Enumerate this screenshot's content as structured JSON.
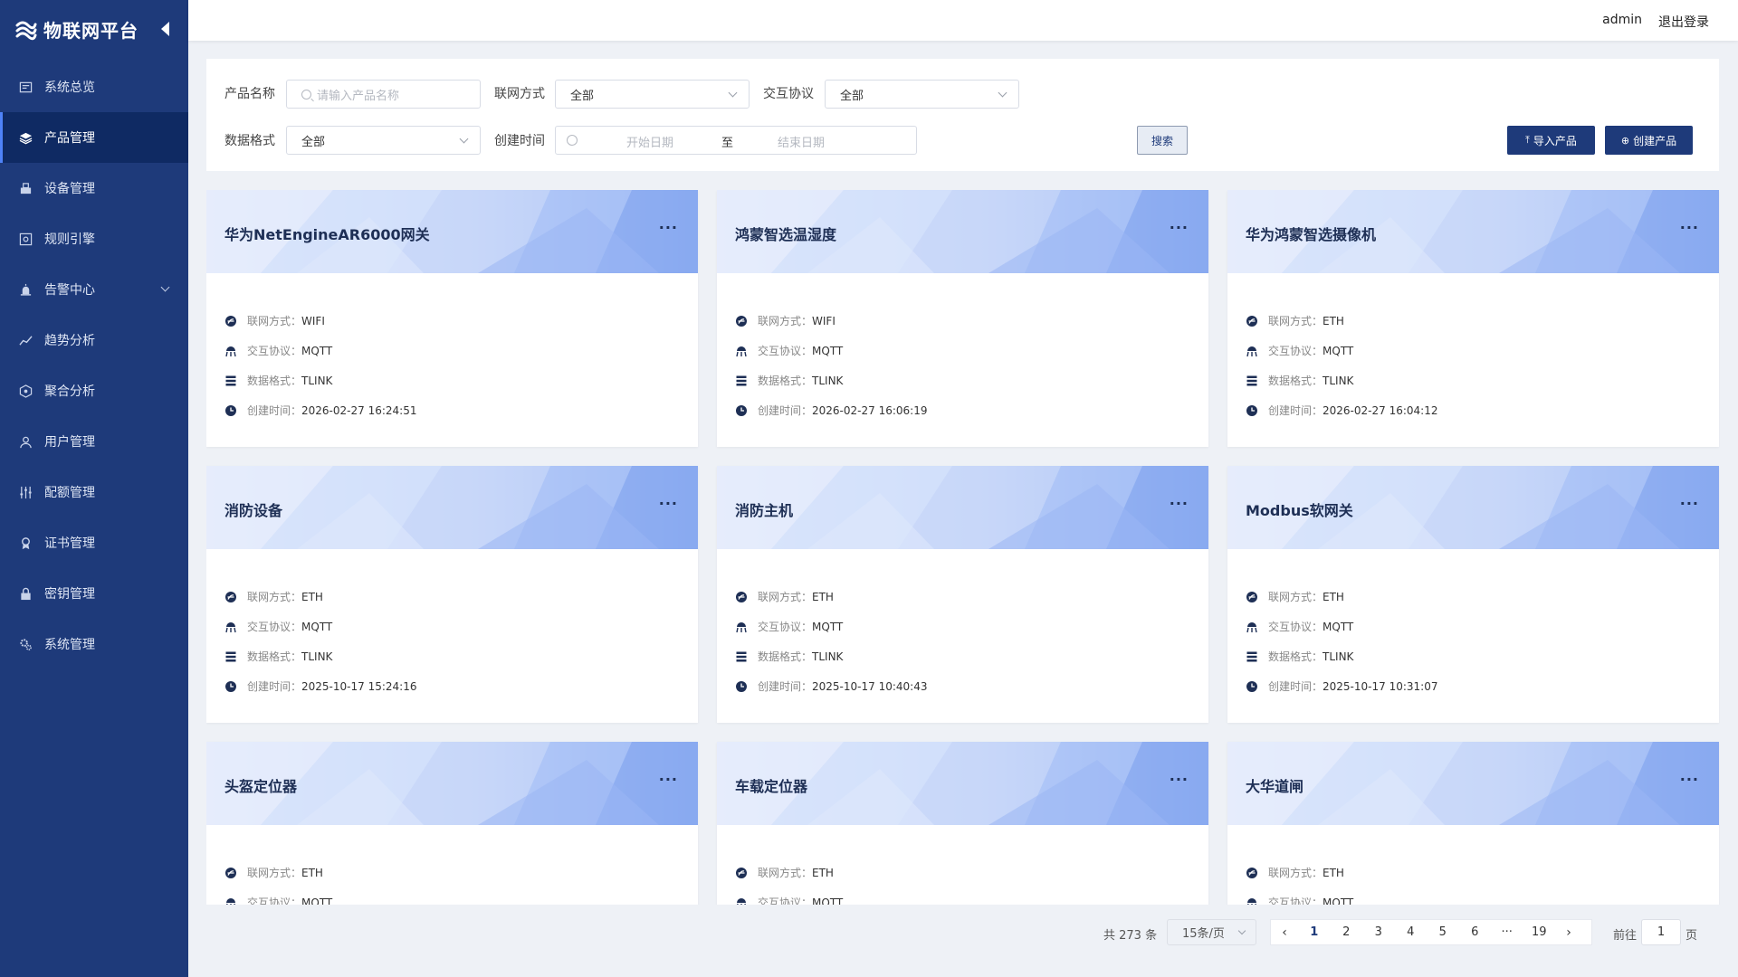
{
  "brand": {
    "title": "物联网平台"
  },
  "sidebar": {
    "items": [
      {
        "label": "系统总览",
        "icon": "dashboard-icon"
      },
      {
        "label": "产品管理",
        "icon": "layers-icon",
        "active": true
      },
      {
        "label": "设备管理",
        "icon": "device-icon"
      },
      {
        "label": "规则引擎",
        "icon": "rule-engine-icon"
      },
      {
        "label": "告警中心",
        "icon": "alarm-icon",
        "expandable": true
      },
      {
        "label": "趋势分析",
        "icon": "trend-icon"
      },
      {
        "label": "聚合分析",
        "icon": "aggregate-icon"
      },
      {
        "label": "用户管理",
        "icon": "user-icon"
      },
      {
        "label": "配额管理",
        "icon": "quota-icon"
      },
      {
        "label": "证书管理",
        "icon": "certificate-icon"
      },
      {
        "label": "密钥管理",
        "icon": "lock-icon"
      },
      {
        "label": "系统管理",
        "icon": "settings-icon"
      }
    ]
  },
  "header": {
    "user": "admin",
    "logout": "退出登录"
  },
  "filters": {
    "product_name_label": "产品名称",
    "product_name_placeholder": "请输入产品名称",
    "network_label": "联网方式",
    "network_value": "全部",
    "protocol_label": "交互协议",
    "protocol_value": "全部",
    "format_label": "数据格式",
    "format_value": "全部",
    "created_label": "创建时间",
    "start_placeholder": "开始日期",
    "range_sep": "至",
    "end_placeholder": "结束日期",
    "search_button": "搜索",
    "import_button": "导入产品",
    "create_button": "创建产品"
  },
  "field_labels": {
    "network": "联网方式：",
    "protocol": "交互协议：",
    "format": "数据格式：",
    "created": "创建时间："
  },
  "more_label": "···",
  "cards": [
    {
      "title": "华为NetEngineAR6000网关",
      "network": "WIFI",
      "protocol": "MQTT",
      "format": "TLINK",
      "created": "2026-02-27 16:24:51"
    },
    {
      "title": "鸿蒙智选温湿度",
      "network": "WIFI",
      "protocol": "MQTT",
      "format": "TLINK",
      "created": "2026-02-27 16:06:19"
    },
    {
      "title": "华为鸿蒙智选摄像机",
      "network": "ETH",
      "protocol": "MQTT",
      "format": "TLINK",
      "created": "2026-02-27 16:04:12"
    },
    {
      "title": "消防设备",
      "network": "ETH",
      "protocol": "MQTT",
      "format": "TLINK",
      "created": "2025-10-17 15:24:16"
    },
    {
      "title": "消防主机",
      "network": "ETH",
      "protocol": "MQTT",
      "format": "TLINK",
      "created": "2025-10-17 10:40:43"
    },
    {
      "title": "Modbus软网关",
      "network": "ETH",
      "protocol": "MQTT",
      "format": "TLINK",
      "created": "2025-10-17 10:31:07"
    },
    {
      "title": "头盔定位器",
      "network": "ETH",
      "protocol": "MQTT"
    },
    {
      "title": "车载定位器",
      "network": "ETH",
      "protocol": "MQTT"
    },
    {
      "title": "大华道闸",
      "network": "ETH",
      "protocol": "MQTT"
    }
  ],
  "pagination": {
    "total": "共 273 条",
    "page_size": "15条/页",
    "pages": [
      "1",
      "2",
      "3",
      "4",
      "5",
      "6",
      "···",
      "19"
    ],
    "current": "1",
    "goto_label": "前往",
    "goto_value": "1",
    "page_suffix": "页"
  },
  "colors": {
    "sidebar": "#1e3a7a",
    "sidebar_active": "#0f2a63",
    "primary": "#1e3a7a",
    "accent": "#4e82f7"
  }
}
